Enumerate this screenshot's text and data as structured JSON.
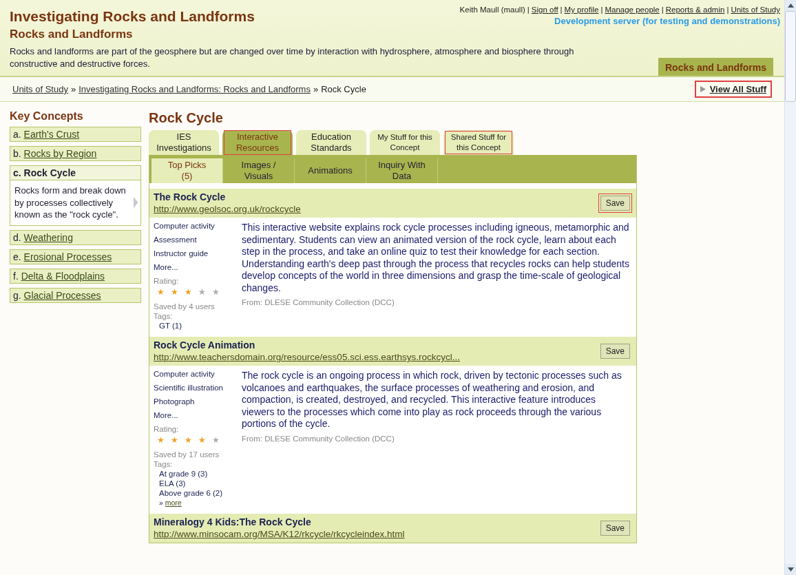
{
  "header": {
    "title": "Investigating Rocks and Landforms",
    "subtitle": "Rocks and Landforms",
    "description": "Rocks and landforms are part of the geosphere but are changed over time by interaction with hydrosphere, atmosphere and biosphere through constructive and destructive forces.",
    "user": "Keith Maull (maull)",
    "link_separator": "|",
    "user_links": [
      "Sign off",
      "My profile",
      "Manage people",
      "Reports & admin",
      "Units of Study"
    ],
    "server_note": "Development server (for testing and demonstrations)",
    "tab": "Rocks and Landforms"
  },
  "breadcrumb": {
    "links": [
      "Units of Study",
      "Investigating Rocks and Landforms: Rocks and Landforms"
    ],
    "separator": "»",
    "current": "Rock Cycle",
    "view_all": {
      "label": "View All Stuff",
      "highlighted": true
    }
  },
  "sidebar": {
    "title": "Key Concepts",
    "items": [
      {
        "letter": "a.",
        "label": "Earth's Crust",
        "selected": false
      },
      {
        "letter": "b.",
        "label": "Rocks by Region",
        "selected": false
      },
      {
        "letter": "c.",
        "label": "Rock Cycle",
        "selected": true,
        "description": "Rocks form and break down by processes collectively known as the \"rock cycle\"."
      },
      {
        "letter": "d.",
        "label": "Weathering",
        "selected": false
      },
      {
        "letter": "e.",
        "label": "Erosional Processes",
        "selected": false
      },
      {
        "letter": "f.",
        "label": "Delta & Floodplains",
        "selected": false
      },
      {
        "letter": "g.",
        "label": "Glacial Processes",
        "selected": false
      }
    ]
  },
  "main": {
    "title": "Rock Cycle",
    "tabs": [
      {
        "label": "IES Investigations",
        "selected": false,
        "highlighted": false,
        "small": false
      },
      {
        "label": "Interactive Resources",
        "selected": true,
        "highlighted": true,
        "small": false
      },
      {
        "label": "Education Standards",
        "selected": false,
        "highlighted": false,
        "small": false
      },
      {
        "label": "My Stuff for this Concept",
        "selected": false,
        "highlighted": false,
        "small": true
      },
      {
        "label": "Shared Stuff for this Concept",
        "selected": false,
        "highlighted": true,
        "small": true
      }
    ],
    "subtabs": [
      {
        "label": "Top Picks (5)",
        "selected": true
      },
      {
        "label": "Images / Visuals",
        "selected": false
      },
      {
        "label": "Animations",
        "selected": false
      },
      {
        "label": "Inquiry With Data",
        "selected": false
      }
    ],
    "resources": [
      {
        "title": "The Rock Cycle",
        "url": "http://www.geolsoc.org.uk/rockcycle",
        "save": "Save",
        "save_highlighted": true,
        "types": [
          "Computer activity",
          "Assessment",
          "Instructor guide"
        ],
        "more": "More...",
        "rating_label": "Rating:",
        "stars": 3,
        "saved_by": "Saved by 4 users",
        "tags_label": "Tags:",
        "tags": [
          "GT (1)"
        ],
        "description": "This interactive website explains rock cycle processes including igneous, metamorphic and sedimentary. Students can view an animated version of the rock cycle, learn about each step in the process, and take an online quiz to test their knowledge for each section. Understanding earth's deep past through the process that recycles rocks can help students develop concepts of the world in three dimensions and grasp the time-scale of geological changes.",
        "source": "From: DLESE Community Collection (DCC)"
      },
      {
        "title": "Rock Cycle Animation",
        "url": "http://www.teachersdomain.org/resource/ess05.sci.ess.earthsys.rockcycl...",
        "save": "Save",
        "save_highlighted": false,
        "types": [
          "Computer activity",
          "Scientific illustration",
          "Photograph"
        ],
        "more": "More...",
        "rating_label": "Rating:",
        "stars": 4,
        "saved_by": "Saved by 17 users",
        "tags_label": "Tags:",
        "tags": [
          "At grade 9 (3)",
          "ELA (3)",
          "Above grade 6 (2)"
        ],
        "tags_more_prefix": "»",
        "tags_more": "more",
        "description": "The rock cycle is an ongoing process in which rock, driven by tectonic processes such as volcanoes and earthquakes, the surface processes of weathering and erosion, and compaction, is created, destroyed, and recycled. This interactive feature introduces viewers to the processes which come into play as rock proceeds through the various portions of the cycle.",
        "source": "From: DLESE Community Collection (DCC)"
      },
      {
        "title": "Mineralogy 4 Kids:The Rock Cycle",
        "url": "http://www.minsocam.org/MSA/K12/rkcycle/rkcycleindex.html",
        "save": "Save",
        "save_highlighted": false
      }
    ]
  }
}
